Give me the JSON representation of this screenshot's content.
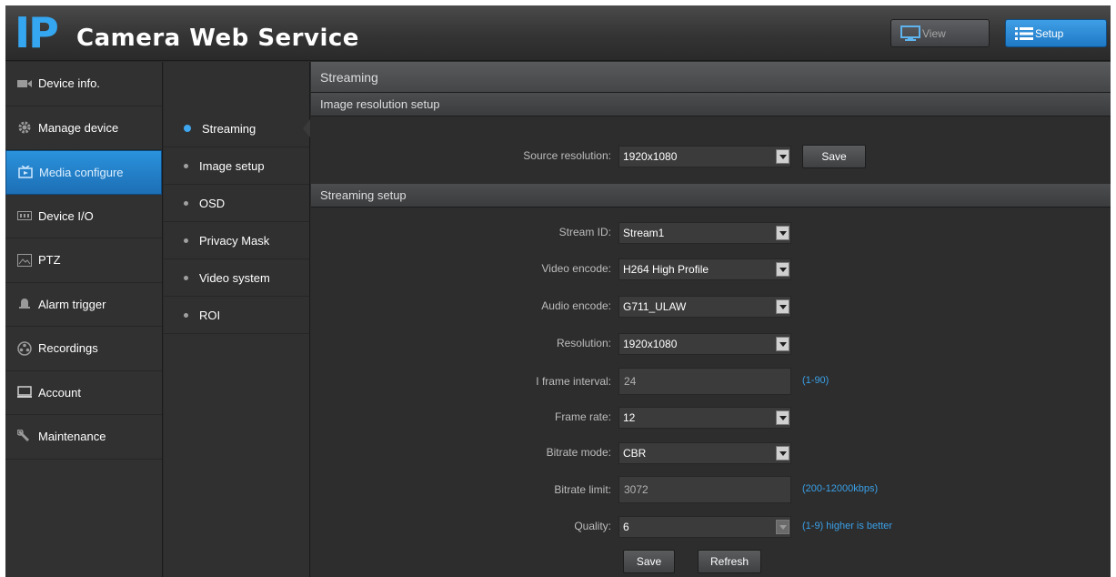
{
  "header": {
    "logo_ip": "IP",
    "logo_text": "Camera Web Service",
    "view_label": "View",
    "setup_label": "Setup"
  },
  "nav": {
    "items": [
      {
        "label": "Device info.",
        "icon": "camera-icon"
      },
      {
        "label": "Manage device",
        "icon": "gear-icon"
      },
      {
        "label": "Media configure",
        "icon": "media-icon"
      },
      {
        "label": "Device I/O",
        "icon": "io-icon"
      },
      {
        "label": "PTZ",
        "icon": "ptz-icon"
      },
      {
        "label": "Alarm trigger",
        "icon": "bell-icon"
      },
      {
        "label": "Recordings",
        "icon": "reel-icon"
      },
      {
        "label": "Account",
        "icon": "monitor-icon"
      },
      {
        "label": "Maintenance",
        "icon": "wrench-icon"
      }
    ],
    "active": "Media configure"
  },
  "subnav": {
    "items": [
      "Streaming",
      "Image setup",
      "OSD",
      "Privacy Mask",
      "Video system",
      "ROI"
    ],
    "active": "Streaming"
  },
  "content": {
    "page_title": "Streaming",
    "image_section": {
      "title": "Image resolution setup",
      "source_resolution_label": "Source resolution:",
      "source_resolution_value": "1920x1080",
      "save_label": "Save"
    },
    "stream_section": {
      "title": "Streaming setup",
      "stream_id_label": "Stream ID:",
      "stream_id_value": "Stream1",
      "video_encode_label": "Video encode:",
      "video_encode_value": "H264 High Profile",
      "audio_encode_label": "Audio encode:",
      "audio_encode_value": "G711_ULAW",
      "resolution_label": "Resolution:",
      "resolution_value": "1920x1080",
      "iframe_label": "I frame interval:",
      "iframe_value": "24",
      "iframe_hint": "(1-90)",
      "frame_rate_label": "Frame rate:",
      "frame_rate_value": "12",
      "bitrate_mode_label": "Bitrate mode:",
      "bitrate_mode_value": "CBR",
      "bitrate_limit_label": "Bitrate limit:",
      "bitrate_limit_value": "3072",
      "bitrate_limit_hint": "(200-12000kbps)",
      "quality_label": "Quality:",
      "quality_value": "6",
      "quality_hint": "(1-9) higher is better",
      "save_label": "Save",
      "refresh_label": "Refresh"
    }
  },
  "colors": {
    "accent": "#2a92dc",
    "logo": "#35a6f0",
    "hint": "#3aa0e8"
  }
}
